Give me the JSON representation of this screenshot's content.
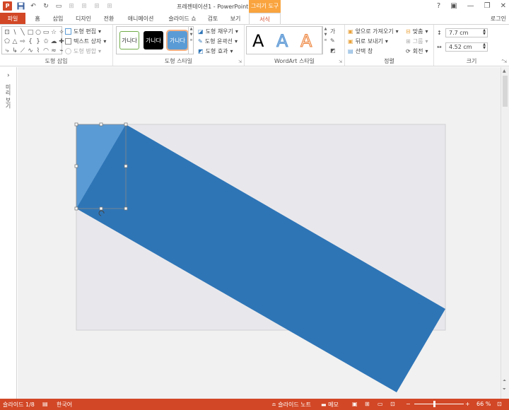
{
  "app": {
    "title": "프레젠테이션1 - PowerPoint",
    "contextual_tab_group": "그리기 도구",
    "logo_letter": "P",
    "login": "로그인"
  },
  "tabs": [
    "파일",
    "홈",
    "삽입",
    "디자인",
    "전환",
    "애니메이션",
    "슬라이드 쇼",
    "검토",
    "보기",
    "서식"
  ],
  "ribbon": {
    "insert_shapes": {
      "label": "도형 삽입",
      "edit_shape": "도형 편집",
      "text_box": "텍스트 상자",
      "merge_shapes": "도형 병합"
    },
    "shape_styles": {
      "label": "도형 스타일",
      "swatch_text": "가나다",
      "fill": "도형 채우기",
      "outline": "도형 윤곽선",
      "effects": "도형 효과"
    },
    "wordart": {
      "label": "WordArt 스타일",
      "letter": "A"
    },
    "arrange": {
      "label": "정렬",
      "bring_forward": "앞으로 가져오기",
      "send_backward": "뒤로 보내기",
      "selection_pane": "선택 창",
      "align": "맞춤",
      "group": "그룹",
      "rotate": "회전"
    },
    "size": {
      "label": "크기",
      "height": "7.7 cm",
      "width": "4.52 cm"
    }
  },
  "left_panel": {
    "label": "미리 보기"
  },
  "status": {
    "slide": "슬라이드 1/8",
    "language": "한국어",
    "notes": "슬라이드 노트",
    "comments": "메모",
    "zoom": "66 %"
  },
  "colors": {
    "accent": "#d24726",
    "shape_fill": "#2e75b6",
    "shape_light": "#5b9bd5",
    "context_tab": "#f9a43f"
  }
}
